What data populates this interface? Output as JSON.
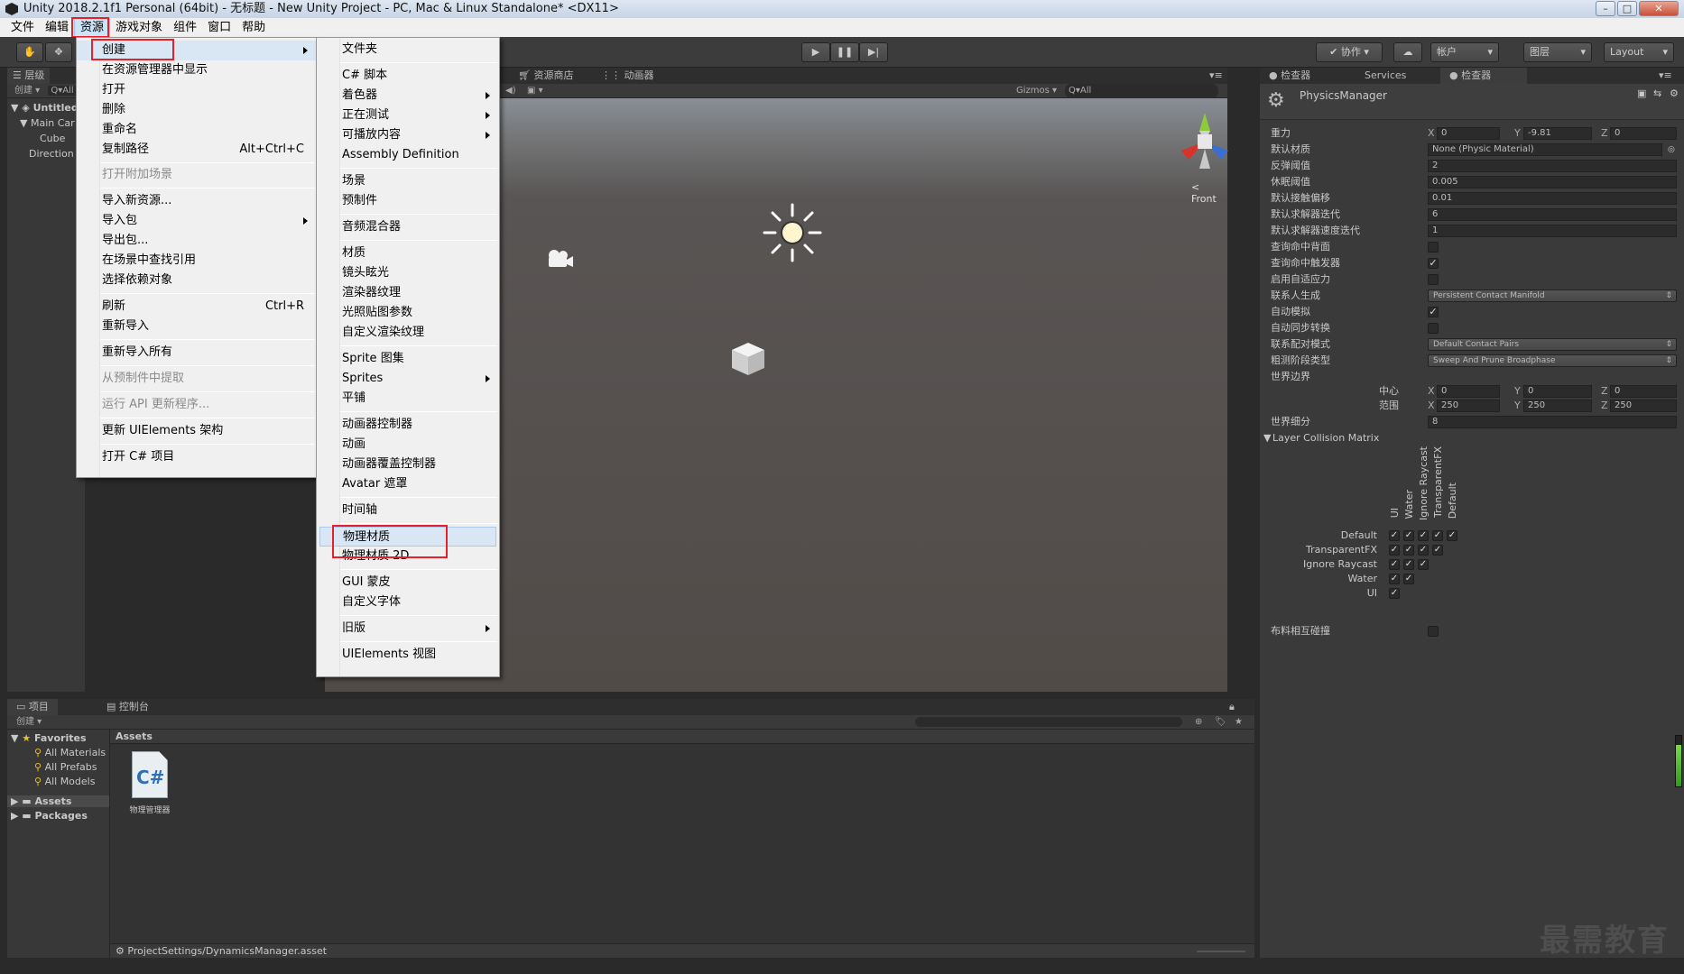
{
  "window": {
    "title": "Unity 2018.2.1f1 Personal (64bit) - 无标题 - New Unity Project - PC, Mac & Linux Standalone* <DX11>",
    "minimize": "–",
    "maximize": "□",
    "close": "✕"
  },
  "menubar": [
    "文件",
    "编辑",
    "资源",
    "游戏对象",
    "组件",
    "窗口",
    "帮助"
  ],
  "toolbar": {
    "collab": "协作",
    "account": "帐户",
    "layers": "图层",
    "layout": "Layout"
  },
  "hierarchy": {
    "tab": "层级",
    "create": "创建",
    "search_placeholder": "Q▾All",
    "scene": "Untitled",
    "items": [
      "Main Car",
      "Cube",
      "Direction"
    ]
  },
  "scene": {
    "tabs": [
      "资源商店",
      "动画器"
    ],
    "gizmos": "Gizmos",
    "search_placeholder": "Q▾All",
    "front": "< Front"
  },
  "assets_menu": {
    "items": [
      {
        "label": "创建",
        "arrow": true
      },
      {
        "label": "在资源管理器中显示"
      },
      {
        "label": "打开"
      },
      {
        "label": "删除"
      },
      {
        "label": "重命名"
      },
      {
        "label": "复制路径",
        "shortcut": "Alt+Ctrl+C"
      },
      {
        "label": "打开附加场景",
        "disabled": true
      },
      {
        "label": "导入新资源..."
      },
      {
        "label": "导入包",
        "arrow": true
      },
      {
        "label": "导出包..."
      },
      {
        "label": "在场景中查找引用"
      },
      {
        "label": "选择依赖对象"
      },
      {
        "label": "刷新",
        "shortcut": "Ctrl+R"
      },
      {
        "label": "重新导入"
      },
      {
        "label": "重新导入所有"
      },
      {
        "label": "从预制件中提取",
        "disabled": true
      },
      {
        "label": "运行 API 更新程序...",
        "disabled": true
      },
      {
        "label": "更新 UIElements 架构"
      },
      {
        "label": "打开 C# 项目"
      }
    ]
  },
  "create_menu": {
    "items": [
      {
        "label": "文件夹"
      },
      {
        "label": "C# 脚本"
      },
      {
        "label": "着色器",
        "arrow": true
      },
      {
        "label": "正在测试",
        "arrow": true
      },
      {
        "label": "可播放内容",
        "arrow": true
      },
      {
        "label": "Assembly Definition"
      },
      {
        "label": "场景"
      },
      {
        "label": "预制件"
      },
      {
        "label": "音频混合器"
      },
      {
        "label": "材质"
      },
      {
        "label": "镜头眩光"
      },
      {
        "label": "渲染器纹理"
      },
      {
        "label": "光照贴图参数"
      },
      {
        "label": "自定义渲染纹理"
      },
      {
        "label": "Sprite 图集"
      },
      {
        "label": "Sprites",
        "arrow": true
      },
      {
        "label": "平铺"
      },
      {
        "label": "动画器控制器"
      },
      {
        "label": "动画"
      },
      {
        "label": "动画器覆盖控制器"
      },
      {
        "label": "Avatar 遮罩"
      },
      {
        "label": "时间轴"
      },
      {
        "label": "物理材质"
      },
      {
        "label": "物理材质 2D"
      },
      {
        "label": "GUI 蒙皮"
      },
      {
        "label": "自定义字体"
      },
      {
        "label": "旧版",
        "arrow": true
      },
      {
        "label": "UIElements 视图"
      }
    ]
  },
  "inspector": {
    "tabs": [
      "检查器",
      "Services",
      "检查器"
    ],
    "object": "PhysicsManager",
    "gravity": {
      "label": "重力",
      "x": "0",
      "y": "-9.81",
      "z": "0"
    },
    "rows": [
      {
        "label": "默认材质",
        "value": "None (Physic Material)"
      },
      {
        "label": "反弹阈值",
        "value": "2"
      },
      {
        "label": "休眠阈值",
        "value": "0.005"
      },
      {
        "label": "默认接触偏移",
        "value": "0.01"
      },
      {
        "label": "默认求解器迭代",
        "value": "6"
      },
      {
        "label": "默认求解器速度迭代",
        "value": "1"
      }
    ],
    "checks": [
      {
        "label": "查询命中背面",
        "checked": false
      },
      {
        "label": "查询命中触发器",
        "checked": true
      },
      {
        "label": "启用自适应力",
        "checked": false
      }
    ],
    "contacts_gen": {
      "label": "联系人生成",
      "value": "Persistent Contact Manifold"
    },
    "auto_sim": {
      "label": "自动模拟",
      "checked": true
    },
    "auto_sync": {
      "label": "自动同步转换",
      "checked": false
    },
    "pairs_mode": {
      "label": "联系配对模式",
      "value": "Default Contact Pairs"
    },
    "broadphase": {
      "label": "粗测阶段类型",
      "value": "Sweep And Prune Broadphase"
    },
    "world_bounds": {
      "label": "世界边界",
      "center_label": "中心",
      "cx": "0",
      "cy": "0",
      "cz": "0",
      "extent_label": "范围",
      "ex": "250",
      "ey": "250",
      "ez": "250"
    },
    "world_subdiv": {
      "label": "世界细分",
      "value": "8"
    },
    "matrix_title": "Layer Collision Matrix",
    "layers": [
      "Default",
      "TransparentFX",
      "Ignore Raycast",
      "Water",
      "UI"
    ],
    "cloth": {
      "label": "布料相互碰撞",
      "checked": false
    }
  },
  "project": {
    "tabs": [
      "项目",
      "控制台"
    ],
    "create": "创建",
    "favorites": "Favorites",
    "fav_items": [
      "All Materials",
      "All Prefabs",
      "All Models"
    ],
    "assets": "Assets",
    "packages": "Packages",
    "breadcrumb": "Assets",
    "asset_name": "物理管理器",
    "asset_icon_text": "C#",
    "status": "ProjectSettings/DynamicsManager.asset"
  },
  "watermark": "最需教育"
}
